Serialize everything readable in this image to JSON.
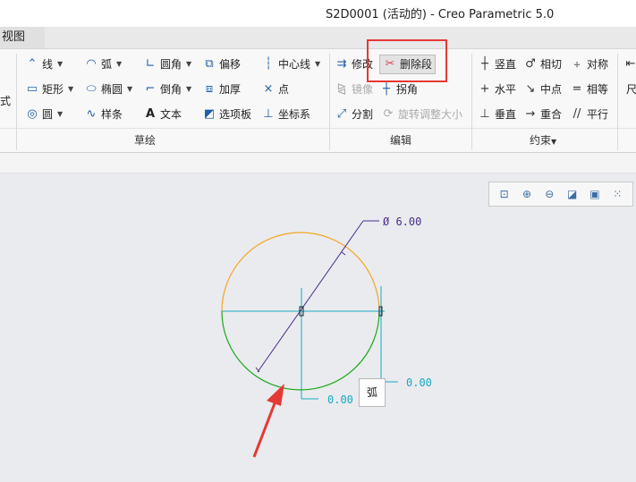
{
  "window": {
    "title": "S2D0001 (活动的) - Creo Parametric 5.0"
  },
  "tabs": {
    "view": "视图"
  },
  "ribbon": {
    "sketch": {
      "label": "草绘",
      "partial_left": [
        "式"
      ],
      "tools": {
        "line": "线",
        "arc": "弧",
        "fillet": "圆角",
        "offset": "偏移",
        "centerline": "中心线",
        "rectangle": "矩形",
        "ellipse": "椭圆",
        "chamfer": "倒角",
        "thicken": "加厚",
        "point": "点",
        "circle": "圆",
        "spline": "样条",
        "text": "文本",
        "palette": "选项板",
        "coordsys": "坐标系"
      }
    },
    "edit": {
      "label": "编辑",
      "tools": {
        "modify": "修改",
        "delete_segment": "删除段",
        "mirror": "镜像",
        "corner": "拐角",
        "divide": "分割",
        "rotate_resize": "旋转调整大小"
      }
    },
    "constraint": {
      "label": "约束",
      "tools": {
        "vertical": "竖直",
        "tangent": "相切",
        "symmetric": "对称",
        "horizontal": "水平",
        "midpoint": "中点",
        "equal": "相等",
        "perpendicular": "垂直",
        "coincident": "重合",
        "parallel": "平行"
      }
    },
    "partial_right": "尺"
  },
  "canvas": {
    "dimensions": {
      "diameter": "Ø 6.00",
      "right": "0.00",
      "bottom": "0.00"
    },
    "tooltip": "弧"
  },
  "colors": {
    "highlight": "#e53935",
    "arc_orange": "#f5a623",
    "arc_green": "#1aa81a",
    "axis": "#19a9c4",
    "dim_line": "#4b2b8f",
    "arrow": "#e53935"
  }
}
